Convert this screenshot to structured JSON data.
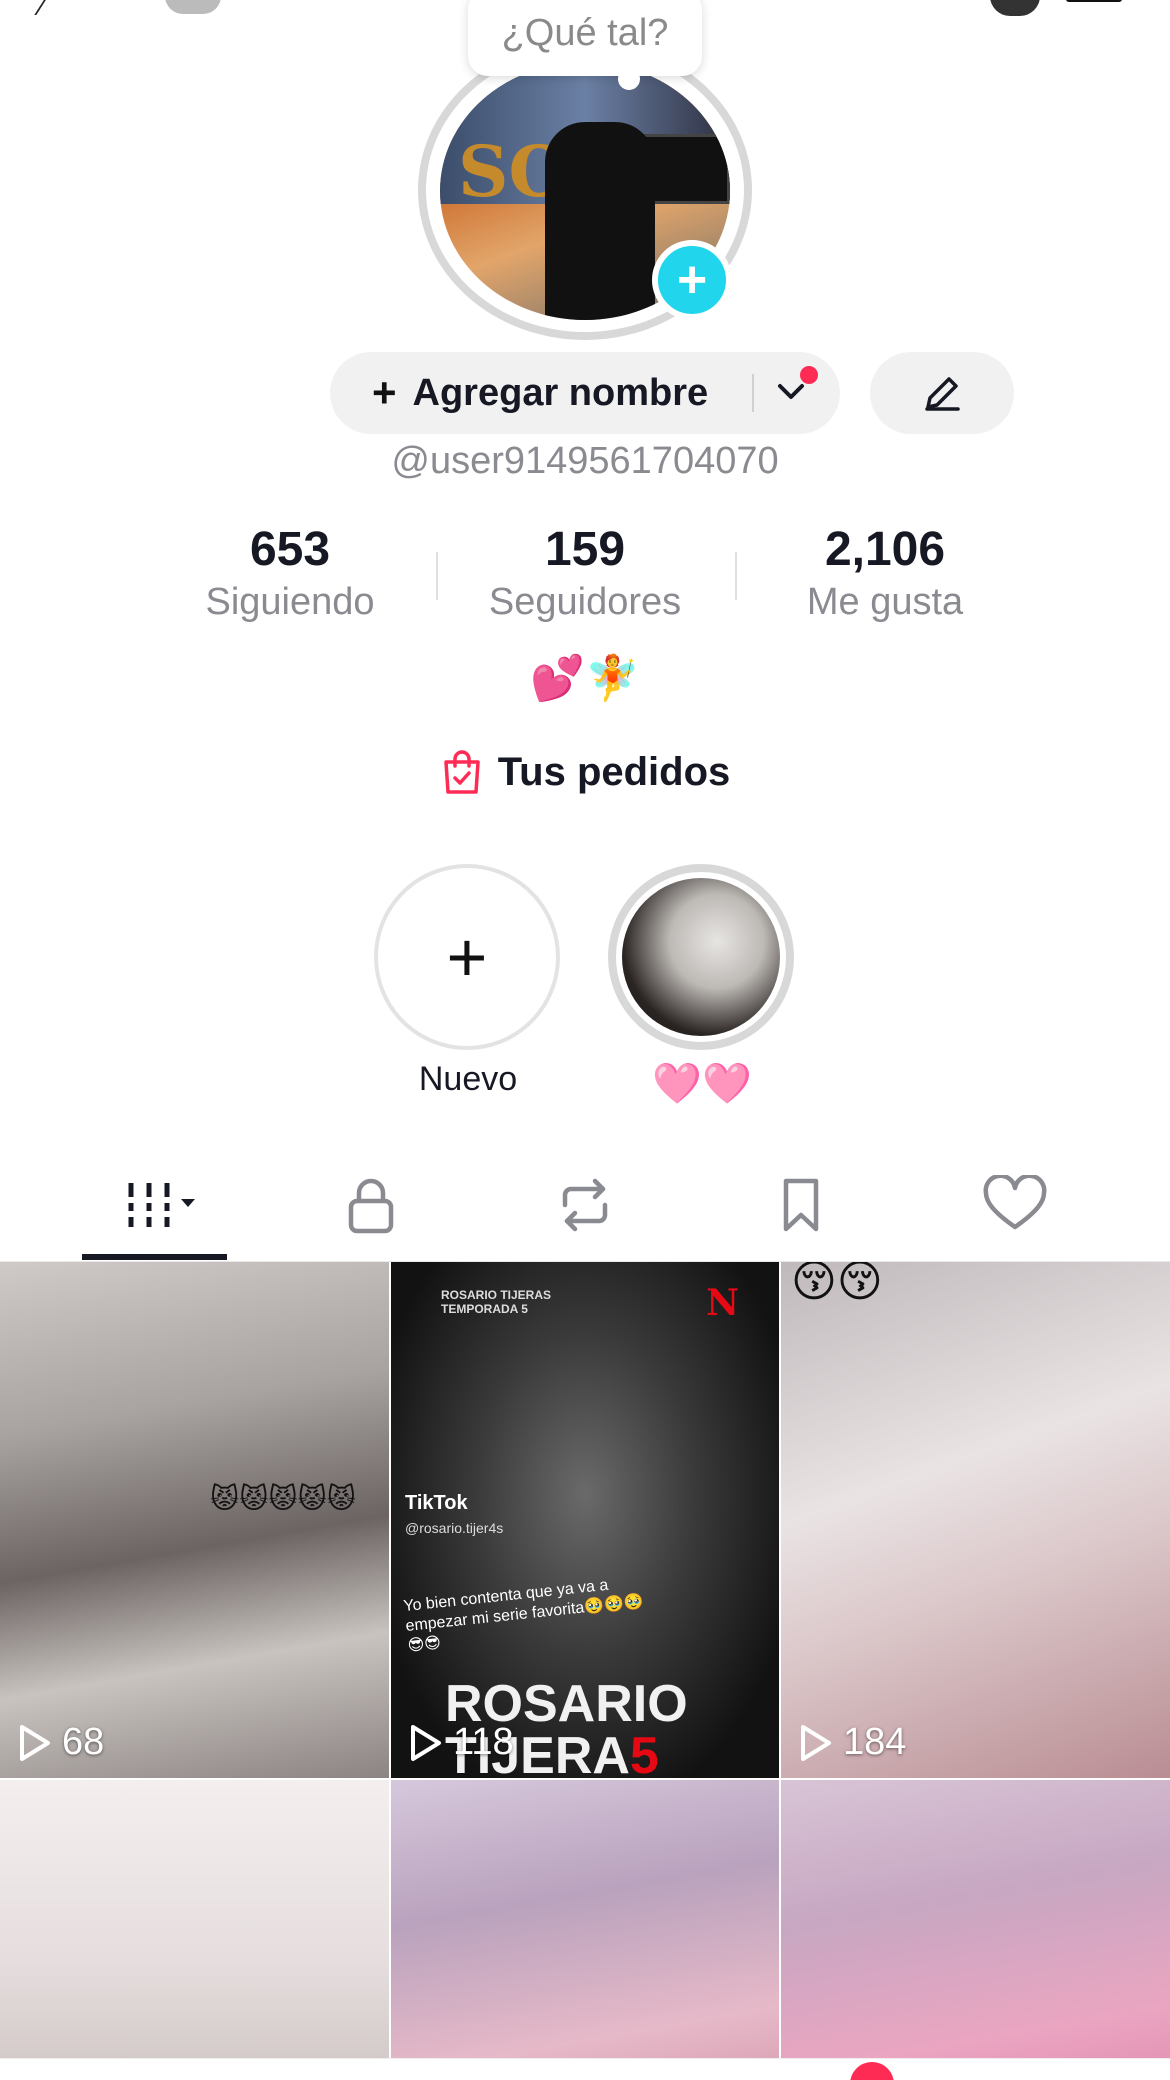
{
  "speech_bubble": {
    "text": "¿Qué tal?"
  },
  "profile": {
    "add_name_label": "Agregar nombre",
    "username": "@user9149561704070",
    "bio": "💕🧚",
    "avatar_text": "SOL"
  },
  "stats": [
    {
      "value": "653",
      "label": "Siguiendo"
    },
    {
      "value": "159",
      "label": "Seguidores"
    },
    {
      "value": "2,106",
      "label": "Me gusta"
    }
  ],
  "orders": {
    "label": "Tus pedidos"
  },
  "highlights": [
    {
      "label": "Nuevo",
      "type": "add"
    },
    {
      "label": "🩷🩷",
      "type": "image"
    }
  ],
  "tabs": [
    {
      "name": "videos",
      "icon": "grid-icon",
      "active": true
    },
    {
      "name": "private",
      "icon": "lock-icon"
    },
    {
      "name": "reposts",
      "icon": "repost-icon"
    },
    {
      "name": "favorites",
      "icon": "bookmark-icon"
    },
    {
      "name": "liked",
      "icon": "heart-icon"
    }
  ],
  "videos": [
    {
      "views": "68",
      "emoji": "😾😾😾😾😾"
    },
    {
      "views": "118",
      "overlay_top": "ROSARIO TIJERAS\nTEMPORADA 5",
      "brand": "N",
      "tiktok": "TikTok",
      "handle": "@rosario.tijer4s",
      "caption": "Yo bien contenta que ya va a empezar mi serie favorita🥹🥹🥹😎😎",
      "title_line1": "ROSARIO",
      "title_line2": "TIJERA",
      "title_digit": "5"
    },
    {
      "views": "184",
      "emoji": "😚😚"
    },
    {
      "views": ""
    },
    {
      "views": ""
    },
    {
      "views": ""
    }
  ],
  "colors": {
    "accent_cyan": "#20d5ec",
    "accent_red": "#fe2c55",
    "text_primary": "#161823",
    "text_secondary": "#8a8b91"
  }
}
